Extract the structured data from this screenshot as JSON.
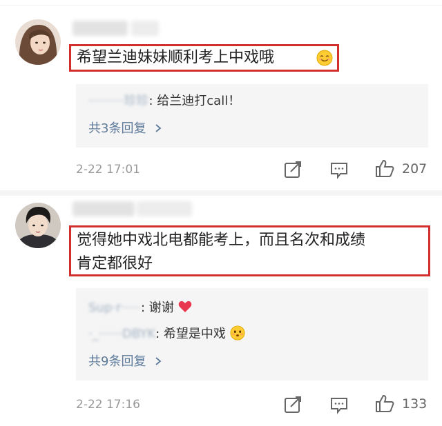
{
  "comments": [
    {
      "text": "希望兰迪妹妹顺利考上中戏哦",
      "emoji": "smiling-face",
      "replies": [
        {
          "user_blurred": "·········珍珍",
          "text": ": 给兰迪打call！"
        }
      ],
      "reply_count_label": "共3条回复",
      "date": "2-22 17:01",
      "likes": "207"
    },
    {
      "text_line1": "觉得她中戏北电都能考上，而且名次和成绩",
      "text_line2": "肯定都很好",
      "replies": [
        {
          "user_blurred": "Sup·r·····",
          "text": ": 谢谢"
        },
        {
          "user_blurred": "·_······DBYK",
          "text": ": 希望是中戏"
        }
      ],
      "reply_count_label": "共9条回复",
      "date": "2-22 17:16",
      "likes": "133"
    }
  ],
  "colors": {
    "highlight_border": "#d32f2f",
    "link": "#5d7a9a",
    "reply_bg": "#f5f5f5",
    "meta": "#999999"
  },
  "icons": [
    "chevron-right-icon",
    "forward-icon",
    "comment-icon",
    "like-icon",
    "heart-icon",
    "smile-emoji",
    "shy-emoji"
  ]
}
